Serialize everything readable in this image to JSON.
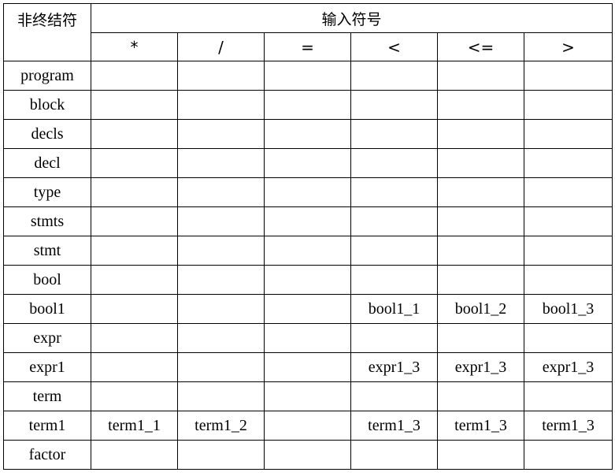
{
  "table": {
    "corner_label": "非终结符",
    "group_header": "输入符号",
    "symbols": [
      "*",
      "/",
      "=",
      "<",
      "<=",
      ">"
    ],
    "rows": [
      {
        "nonterminal": "program",
        "cells": [
          "",
          "",
          "",
          "",
          "",
          ""
        ]
      },
      {
        "nonterminal": "block",
        "cells": [
          "",
          "",
          "",
          "",
          "",
          ""
        ]
      },
      {
        "nonterminal": "decls",
        "cells": [
          "",
          "",
          "",
          "",
          "",
          ""
        ]
      },
      {
        "nonterminal": "decl",
        "cells": [
          "",
          "",
          "",
          "",
          "",
          ""
        ]
      },
      {
        "nonterminal": "type",
        "cells": [
          "",
          "",
          "",
          "",
          "",
          ""
        ]
      },
      {
        "nonterminal": "stmts",
        "cells": [
          "",
          "",
          "",
          "",
          "",
          ""
        ]
      },
      {
        "nonterminal": "stmt",
        "cells": [
          "",
          "",
          "",
          "",
          "",
          ""
        ]
      },
      {
        "nonterminal": "bool",
        "cells": [
          "",
          "",
          "",
          "",
          "",
          ""
        ]
      },
      {
        "nonterminal": "bool1",
        "cells": [
          "",
          "",
          "",
          "bool1_1",
          "bool1_2",
          "bool1_3"
        ]
      },
      {
        "nonterminal": "expr",
        "cells": [
          "",
          "",
          "",
          "",
          "",
          ""
        ]
      },
      {
        "nonterminal": "expr1",
        "cells": [
          "",
          "",
          "",
          "expr1_3",
          "expr1_3",
          "expr1_3"
        ]
      },
      {
        "nonterminal": "term",
        "cells": [
          "",
          "",
          "",
          "",
          "",
          ""
        ]
      },
      {
        "nonterminal": "term1",
        "cells": [
          "term1_1",
          "term1_2",
          "",
          "term1_3",
          "term1_3",
          "term1_3"
        ]
      },
      {
        "nonterminal": "factor",
        "cells": [
          "",
          "",
          "",
          "",
          "",
          ""
        ]
      }
    ]
  }
}
